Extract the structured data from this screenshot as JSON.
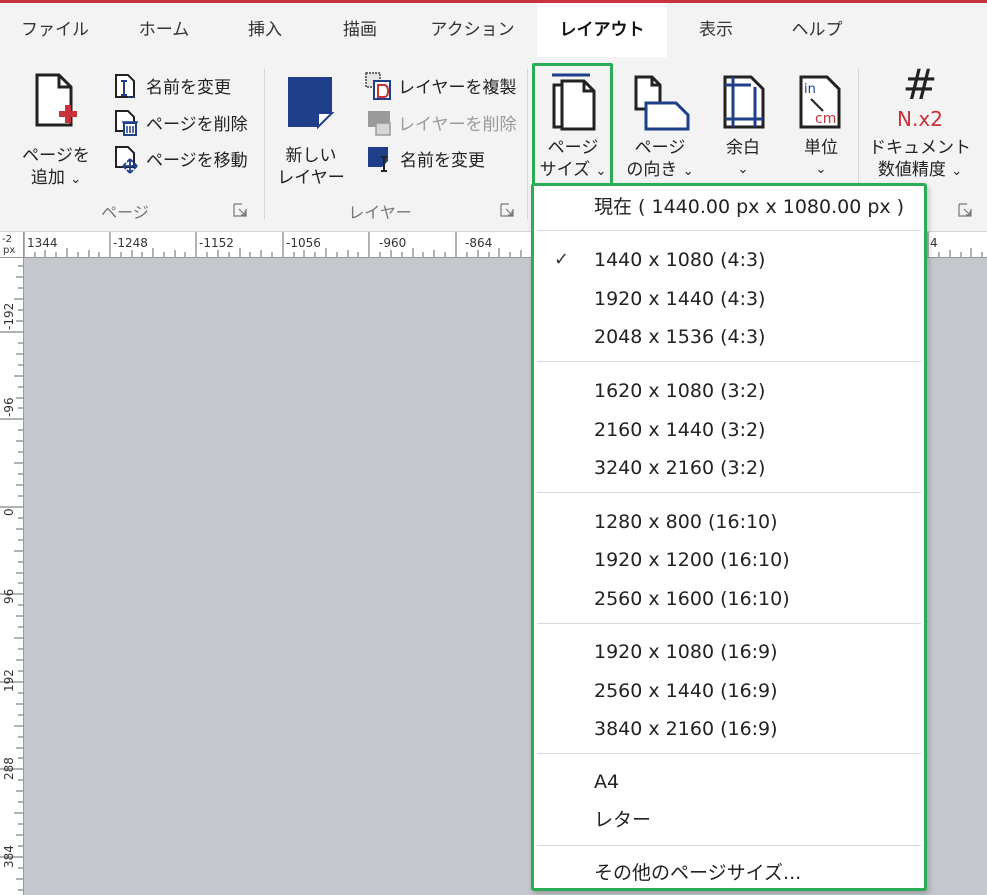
{
  "tabs": [
    "ファイル",
    "ホーム",
    "挿入",
    "描画",
    "アクション",
    "レイアウト",
    "表示",
    "ヘルプ"
  ],
  "active_tab": "レイアウト",
  "ribbon": {
    "page_group": {
      "add_page_line1": "ページを",
      "add_page_line2": "追加",
      "rename": "名前を変更",
      "delete_page": "ページを削除",
      "move_page": "ページを移動",
      "group_label": "ページ"
    },
    "layer_group": {
      "new_layer_line1": "新しい",
      "new_layer_line2": "レイヤー",
      "duplicate_layer": "レイヤーを複製",
      "delete_layer": "レイヤーを削除",
      "rename": "名前を変更",
      "group_label": "レイヤー"
    },
    "layout_group": {
      "page_size_line1": "ページ",
      "page_size_line2": "サイズ",
      "orientation_line1": "ページ",
      "orientation_line2": "の向き",
      "margins": "余白",
      "units": "単位",
      "precision_line1": "ドキュメント",
      "precision_line2": "数値精度",
      "units_icon_in": "in",
      "units_icon_cm": "cm",
      "precision_icon_hash": "#",
      "precision_icon_text": "N.x2"
    },
    "chevron": "⌄"
  },
  "ruler": {
    "unit": "px",
    "corner_label": "-2",
    "horizontal": [
      "1344",
      "-1248",
      "-1152",
      "-1056",
      "-960",
      "-864",
      "4"
    ],
    "vertical": [
      "-192",
      "-96",
      "0",
      "96",
      "192",
      "288",
      "384"
    ]
  },
  "page_size_menu": {
    "current": "現在 ( 1440.00 px x 1080.00 px )",
    "checked_item": "1440 x 1080 (4:3)",
    "groups": [
      [
        "1440 x 1080 (4:3)",
        "1920 x 1440 (4:3)",
        "2048 x 1536 (4:3)"
      ],
      [
        "1620 x 1080 (3:2)",
        "2160 x 1440 (3:2)",
        "3240 x 2160 (3:2)"
      ],
      [
        "1280 x 800 (16:10)",
        "1920 x 1200 (16:10)",
        "2560 x 1600 (16:10)"
      ],
      [
        "1920 x 1080 (16:9)",
        "2560 x 1440 (16:9)",
        "3840 x 2160 (16:9)"
      ],
      [
        "A4",
        "レター"
      ]
    ],
    "more": "その他のページサイズ..."
  },
  "colors": {
    "accent_red": "#c8323a",
    "highlight_green": "#2aad56",
    "icon_blue": "#1f3f8a",
    "canvas_gray": "#c4c7cc"
  },
  "icons": [
    "add-page-icon",
    "rename-page-icon",
    "delete-page-icon",
    "move-page-icon",
    "new-layer-icon",
    "duplicate-layer-icon",
    "delete-layer-icon",
    "rename-layer-icon",
    "page-size-icon",
    "orientation-icon",
    "margins-icon",
    "units-icon",
    "precision-icon",
    "dialog-launcher-icon",
    "checkmark-icon"
  ]
}
